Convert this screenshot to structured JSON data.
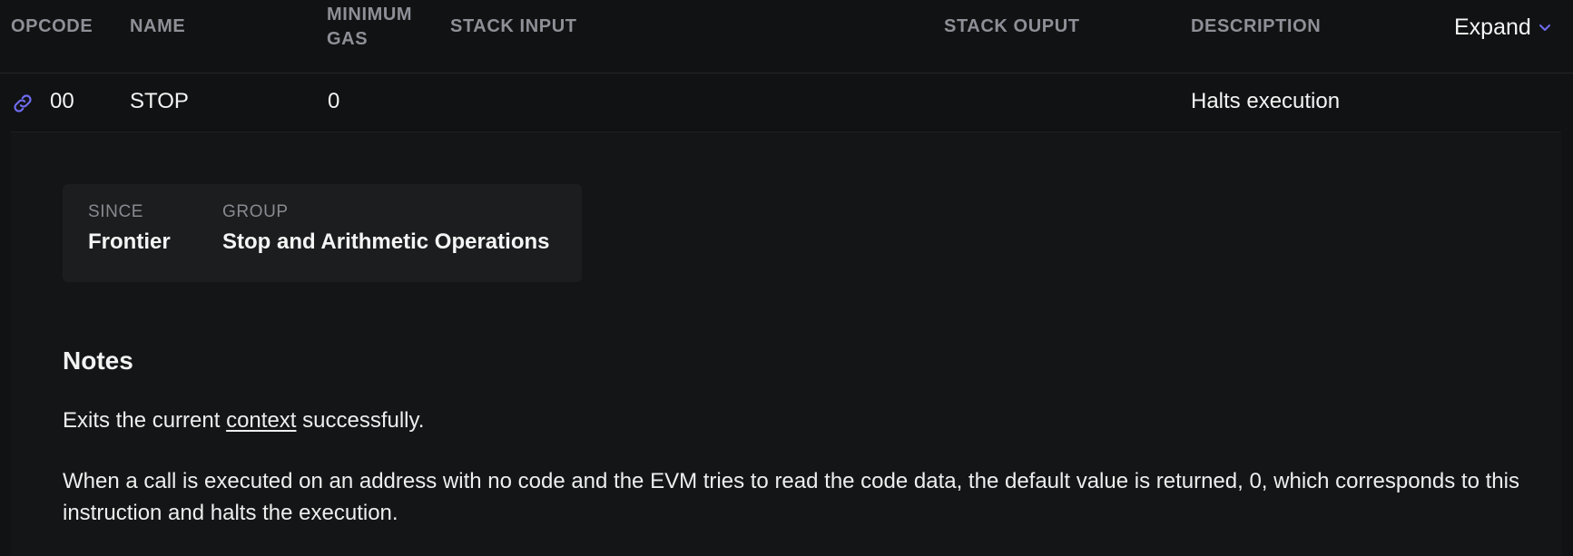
{
  "table": {
    "headers": {
      "opcode": "OPCODE",
      "name": "NAME",
      "min_gas": "MINIMUM GAS",
      "stack_input": "STACK INPUT",
      "stack_output": "STACK OUPUT",
      "description": "DESCRIPTION"
    },
    "expand_label": "Expand",
    "row": {
      "opcode": "00",
      "name": "STOP",
      "min_gas": "0",
      "stack_input": "",
      "stack_output": "",
      "description": "Halts execution"
    }
  },
  "details": {
    "since_label": "SINCE",
    "since_value": "Frontier",
    "group_label": "GROUP",
    "group_value": "Stop and Arithmetic Operations"
  },
  "notes": {
    "title": "Notes",
    "line1_before": "Exits the current ",
    "line1_link": "context",
    "line1_after": " successfully.",
    "line2": "When a call is executed on an address with no code and the EVM tries to read the code data, the default value is returned, 0, which corresponds to this instruction and halts the execution."
  },
  "icons": {
    "link": "link-icon",
    "expand": "chevron-down-icon"
  },
  "colors": {
    "accent": "#6f6cf0",
    "background": "#111213"
  }
}
